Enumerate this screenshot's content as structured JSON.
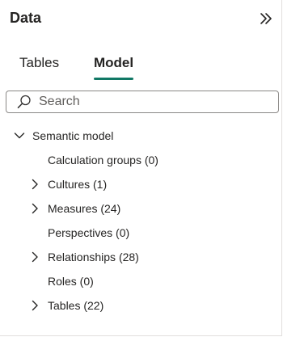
{
  "header": {
    "title": "Data",
    "collapse_icon": "double-chevron-right-icon"
  },
  "tabs": [
    {
      "label": "Tables",
      "selected": false
    },
    {
      "label": "Model",
      "selected": true
    }
  ],
  "accent_color": "#117865",
  "search": {
    "placeholder": "Search",
    "value": "",
    "icon": "search-icon"
  },
  "tree": {
    "root": {
      "label": "Semantic model",
      "expanded": true
    },
    "items": [
      {
        "label": "Calculation groups (0)",
        "expandable": false
      },
      {
        "label": "Cultures (1)",
        "expandable": true
      },
      {
        "label": "Measures (24)",
        "expandable": true
      },
      {
        "label": "Perspectives (0)",
        "expandable": false
      },
      {
        "label": "Relationships (28)",
        "expandable": true
      },
      {
        "label": "Roles (0)",
        "expandable": false
      },
      {
        "label": "Tables (22)",
        "expandable": true
      }
    ]
  }
}
